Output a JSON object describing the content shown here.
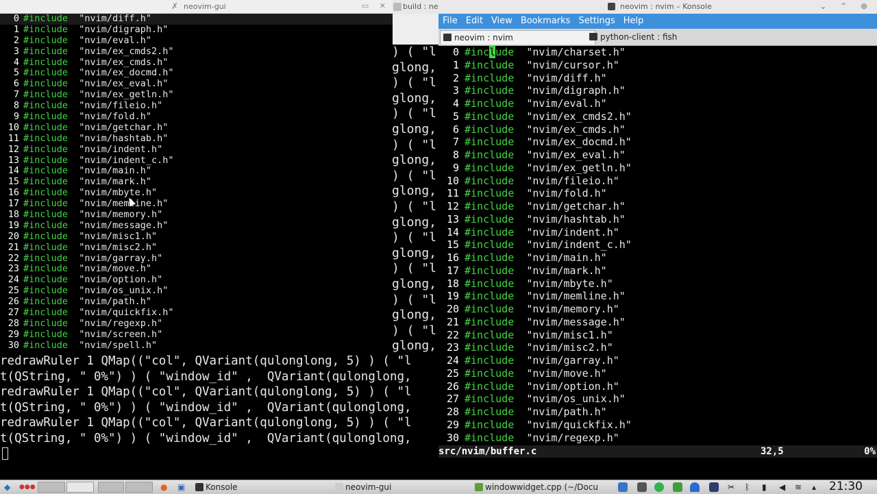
{
  "background_terminal": {
    "build_title": "build : neov",
    "right_fragments": [
      ") ( \"l",
      "glong,",
      ") ( \"l",
      "glong,",
      ") ( \"l",
      "glong,",
      ") ( \"l",
      "glong,",
      ") ( \"l",
      "glong,",
      ") ( \"l",
      "glong,",
      ") ( \"l",
      "glong,",
      ") ( \"l",
      "glong,",
      ") ( \"l",
      "glong,",
      ") ( \"l",
      "glong,"
    ],
    "bottom_lines": [
      "redrawRuler 1 QMap((\"col\", QVariant(qulonglong, 5) ) ( \"l",
      "t(QString, \" 0%\") ) ( \"window_id\" ,  QVariant(qulonglong,",
      "redrawRuler 1 QMap((\"col\", QVariant(qulonglong, 5) ) ( \"l",
      "t(QString, \" 0%\") ) ( \"window_id\" ,  QVariant(qulonglong,",
      "redrawRuler 1 QMap((\"col\", QVariant(qulonglong, 5) ) ( \"l",
      "t(QString, \" 0%\") ) ( \"window_id\" ,  QVariant(qulonglong,"
    ]
  },
  "nvim_gui": {
    "title": "neovim-gui",
    "lines": [
      {
        "n": "0",
        "kw": "#include",
        "str": "\"nvim/diff.h\""
      },
      {
        "n": "1",
        "kw": "#include",
        "str": "\"nvim/digraph.h\""
      },
      {
        "n": "2",
        "kw": "#include",
        "str": "\"nvim/eval.h\""
      },
      {
        "n": "3",
        "kw": "#include",
        "str": "\"nvim/ex_cmds2.h\""
      },
      {
        "n": "4",
        "kw": "#include",
        "str": "\"nvim/ex_cmds.h\""
      },
      {
        "n": "5",
        "kw": "#include",
        "str": "\"nvim/ex_docmd.h\""
      },
      {
        "n": "6",
        "kw": "#include",
        "str": "\"nvim/ex_eval.h\""
      },
      {
        "n": "7",
        "kw": "#include",
        "str": "\"nvim/ex_getln.h\""
      },
      {
        "n": "8",
        "kw": "#include",
        "str": "\"nvim/fileio.h\""
      },
      {
        "n": "9",
        "kw": "#include",
        "str": "\"nvim/fold.h\""
      },
      {
        "n": "10",
        "kw": "#include",
        "str": "\"nvim/getchar.h\""
      },
      {
        "n": "11",
        "kw": "#include",
        "str": "\"nvim/hashtab.h\""
      },
      {
        "n": "12",
        "kw": "#include",
        "str": "\"nvim/indent.h\""
      },
      {
        "n": "13",
        "kw": "#include",
        "str": "\"nvim/indent_c.h\""
      },
      {
        "n": "14",
        "kw": "#include",
        "str": "\"nvim/main.h\""
      },
      {
        "n": "15",
        "kw": "#include",
        "str": "\"nvim/mark.h\""
      },
      {
        "n": "16",
        "kw": "#include",
        "str": "\"nvim/mbyte.h\""
      },
      {
        "n": "17",
        "kw": "#include",
        "str": "\"nvim/memline.h\""
      },
      {
        "n": "18",
        "kw": "#include",
        "str": "\"nvim/memory.h\""
      },
      {
        "n": "19",
        "kw": "#include",
        "str": "\"nvim/message.h\""
      },
      {
        "n": "20",
        "kw": "#include",
        "str": "\"nvim/misc1.h\""
      },
      {
        "n": "21",
        "kw": "#include",
        "str": "\"nvim/misc2.h\""
      },
      {
        "n": "22",
        "kw": "#include",
        "str": "\"nvim/garray.h\""
      },
      {
        "n": "23",
        "kw": "#include",
        "str": "\"nvim/move.h\""
      },
      {
        "n": "24",
        "kw": "#include",
        "str": "\"nvim/option.h\""
      },
      {
        "n": "25",
        "kw": "#include",
        "str": "\"nvim/os_unix.h\""
      },
      {
        "n": "26",
        "kw": "#include",
        "str": "\"nvim/path.h\""
      },
      {
        "n": "27",
        "kw": "#include",
        "str": "\"nvim/quickfix.h\""
      },
      {
        "n": "28",
        "kw": "#include",
        "str": "\"nvim/regexp.h\""
      },
      {
        "n": "29",
        "kw": "#include",
        "str": "\"nvim/screen.h\""
      },
      {
        "n": "30",
        "kw": "#include",
        "str": "\"nvim/spell.h\""
      }
    ]
  },
  "konsole": {
    "title": "neovim : nvim – Konsole",
    "menu": [
      "File",
      "Edit",
      "View",
      "Bookmarks",
      "Settings",
      "Help"
    ],
    "tabs": [
      "neovim : nvim",
      "python-client : fish"
    ],
    "first_line": {
      "n": "0",
      "pre": "#inc",
      "cursor": "l",
      "post": "ude",
      "str": "\"nvim/charset.h\""
    },
    "lines": [
      {
        "n": "1",
        "kw": "#include",
        "str": "\"nvim/cursor.h\""
      },
      {
        "n": "2",
        "kw": "#include",
        "str": "\"nvim/diff.h\""
      },
      {
        "n": "3",
        "kw": "#include",
        "str": "\"nvim/digraph.h\""
      },
      {
        "n": "4",
        "kw": "#include",
        "str": "\"nvim/eval.h\""
      },
      {
        "n": "5",
        "kw": "#include",
        "str": "\"nvim/ex_cmds2.h\""
      },
      {
        "n": "6",
        "kw": "#include",
        "str": "\"nvim/ex_cmds.h\""
      },
      {
        "n": "7",
        "kw": "#include",
        "str": "\"nvim/ex_docmd.h\""
      },
      {
        "n": "8",
        "kw": "#include",
        "str": "\"nvim/ex_eval.h\""
      },
      {
        "n": "9",
        "kw": "#include",
        "str": "\"nvim/ex_getln.h\""
      },
      {
        "n": "10",
        "kw": "#include",
        "str": "\"nvim/fileio.h\""
      },
      {
        "n": "11",
        "kw": "#include",
        "str": "\"nvim/fold.h\""
      },
      {
        "n": "12",
        "kw": "#include",
        "str": "\"nvim/getchar.h\""
      },
      {
        "n": "13",
        "kw": "#include",
        "str": "\"nvim/hashtab.h\""
      },
      {
        "n": "14",
        "kw": "#include",
        "str": "\"nvim/indent.h\""
      },
      {
        "n": "15",
        "kw": "#include",
        "str": "\"nvim/indent_c.h\""
      },
      {
        "n": "16",
        "kw": "#include",
        "str": "\"nvim/main.h\""
      },
      {
        "n": "17",
        "kw": "#include",
        "str": "\"nvim/mark.h\""
      },
      {
        "n": "18",
        "kw": "#include",
        "str": "\"nvim/mbyte.h\""
      },
      {
        "n": "19",
        "kw": "#include",
        "str": "\"nvim/memline.h\""
      },
      {
        "n": "20",
        "kw": "#include",
        "str": "\"nvim/memory.h\""
      },
      {
        "n": "21",
        "kw": "#include",
        "str": "\"nvim/message.h\""
      },
      {
        "n": "22",
        "kw": "#include",
        "str": "\"nvim/misc1.h\""
      },
      {
        "n": "23",
        "kw": "#include",
        "str": "\"nvim/misc2.h\""
      },
      {
        "n": "24",
        "kw": "#include",
        "str": "\"nvim/garray.h\""
      },
      {
        "n": "25",
        "kw": "#include",
        "str": "\"nvim/move.h\""
      },
      {
        "n": "26",
        "kw": "#include",
        "str": "\"nvim/option.h\""
      },
      {
        "n": "27",
        "kw": "#include",
        "str": "\"nvim/os_unix.h\""
      },
      {
        "n": "28",
        "kw": "#include",
        "str": "\"nvim/path.h\""
      },
      {
        "n": "29",
        "kw": "#include",
        "str": "\"nvim/quickfix.h\""
      },
      {
        "n": "30",
        "kw": "#include",
        "str": "\"nvim/regexp.h\""
      }
    ],
    "status": {
      "file": "src/nvim/buffer.c",
      "position": "32,5",
      "percent": "0%"
    }
  },
  "taskbar": {
    "tasks": [
      "Konsole",
      "neovim-gui",
      "windowwidget.cpp (~/Docu"
    ],
    "clock": "21:30"
  },
  "colors": {
    "keyword": "#44d444",
    "menu_bar": "#3d90dc"
  }
}
